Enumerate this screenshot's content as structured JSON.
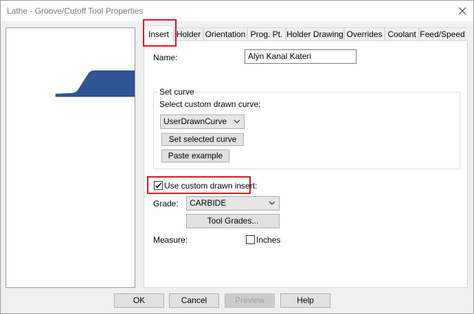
{
  "window": {
    "title": "Lathe - Groove/Cutoff Tool Properties"
  },
  "tabs": [
    {
      "label": "Insert",
      "active": true
    },
    {
      "label": "Holder"
    },
    {
      "label": "Orientation"
    },
    {
      "label": "Prog. Pt."
    },
    {
      "label": "Holder Drawing"
    },
    {
      "label": "Overrides"
    },
    {
      "label": "Coolant"
    },
    {
      "label": "Feed/Speed"
    }
  ],
  "insert": {
    "name_label": "Name:",
    "name_value": "Alýn Kanal Kateri",
    "set_curve": {
      "title": "Set curve",
      "select_label": "Select custom drawn curve:",
      "curve_value": "UserDrawnCurve",
      "set_selected_label": "Set selected curve",
      "paste_example_label": "Paste example"
    },
    "use_custom_label": "Use custom drawn insert:",
    "use_custom_checked": true,
    "grade_label": "Grade:",
    "grade_value": "CARBIDE",
    "tool_grades_label": "Tool Grades...",
    "measure_label": "Measure:",
    "inches_label": "Inches",
    "inches_checked": false
  },
  "footer": {
    "ok_label": "OK",
    "cancel_label": "Cancel",
    "preview_label": "Preview",
    "help_label": "Help"
  },
  "colors": {
    "highlight": "#e8101d",
    "tool_fill": "#2f5597"
  }
}
